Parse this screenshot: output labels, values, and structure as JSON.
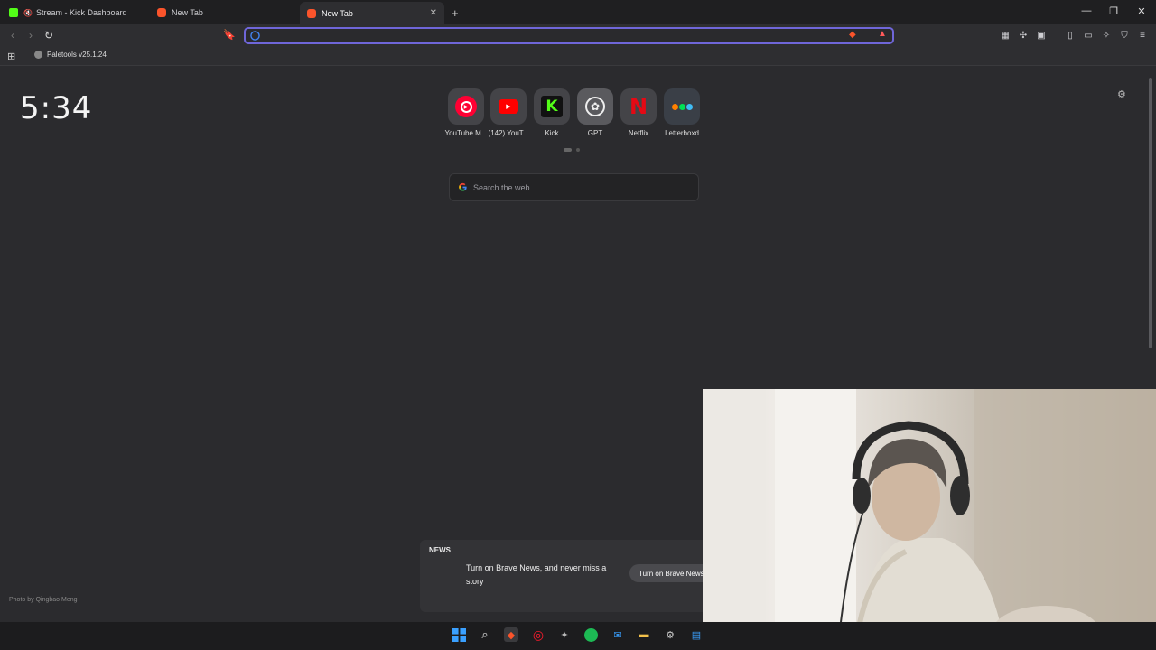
{
  "tabs": [
    {
      "label": "Stream - Kick Dashboard",
      "favicon": "kick-icon"
    },
    {
      "label": "New Tab",
      "favicon": "brave-icon"
    },
    {
      "label": "New Tab",
      "favicon": "brave-icon",
      "active": true
    }
  ],
  "omnibox": {
    "value": "",
    "placeholder": ""
  },
  "bookmarks": [
    {
      "label": "Paletools v25.1.24"
    }
  ],
  "clock": "5:34",
  "top_sites": [
    {
      "label": "YouTube M...",
      "icon": "youtube-music-icon"
    },
    {
      "label": "(142) YouT...",
      "icon": "youtube-icon"
    },
    {
      "label": "Kick",
      "icon": "kick-icon"
    },
    {
      "label": "GPT",
      "icon": "openai-icon"
    },
    {
      "label": "Netflix",
      "icon": "netflix-icon"
    },
    {
      "label": "Letterboxd",
      "icon": "letterboxd-icon"
    }
  ],
  "search": {
    "placeholder": "Search the web"
  },
  "news": {
    "title": "NEWS",
    "text": "Turn on Brave News, and never miss a story",
    "button": "Turn on Brave News"
  },
  "photo_credit": "Photo by Qingbao Meng",
  "colors": {
    "accent": "#6f66d9",
    "kick": "#53fc18",
    "netflix": "#e50914",
    "youtube": "#ff0000"
  }
}
